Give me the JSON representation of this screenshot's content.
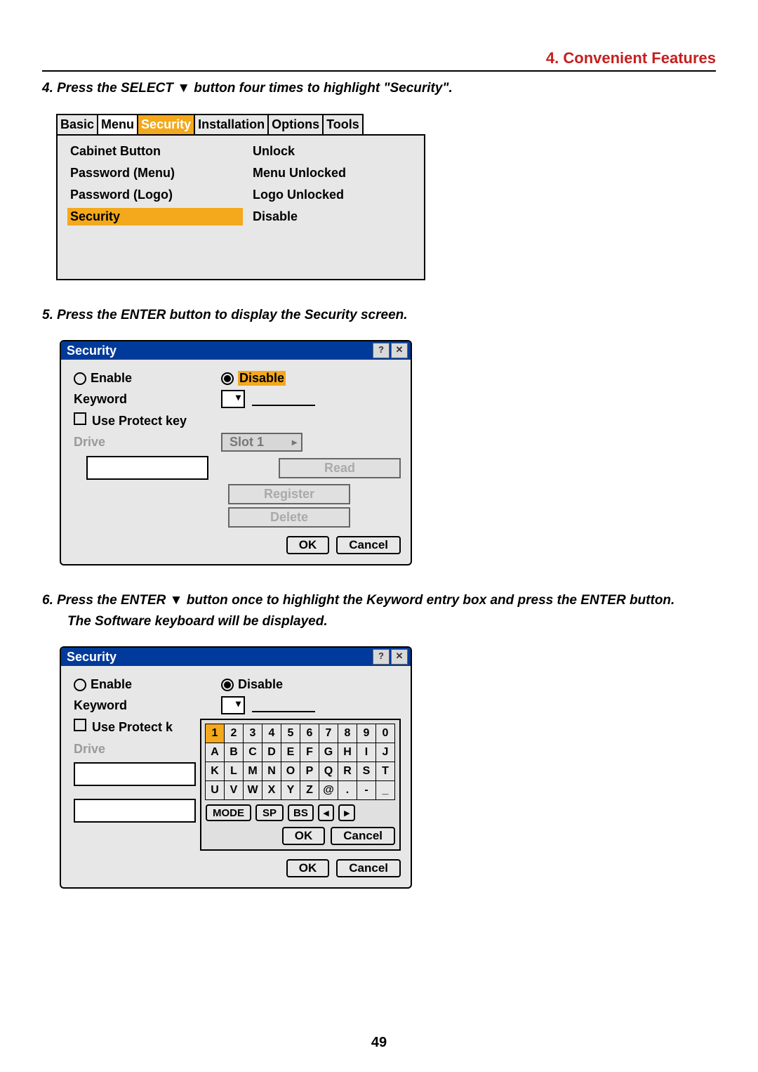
{
  "chapterTitle": "4. Convenient Features",
  "step4_pre": "4. Press the SELECT ",
  "triDown": "▼",
  "step4_post": " button four times to highlight \"Security\".",
  "tabs": [
    "Basic",
    "Menu",
    "Security",
    "Installation",
    "Options",
    "Tools"
  ],
  "p1_left": [
    "Cabinet Button",
    "Password (Menu)",
    "Password (Logo)",
    "Security"
  ],
  "p1_right": [
    "Unlock",
    "Menu Unlocked",
    "Logo Unlocked",
    "Disable"
  ],
  "step5": "5. Press the ENTER button to display the Security screen.",
  "dlg_title": "Security",
  "enable": "Enable",
  "disable": "Disable",
  "keyword": "Keyword",
  "useProtect": "Use Protect key",
  "useProtectShort": "Use Protect k",
  "drive": "Drive",
  "slot": "Slot 1",
  "read": "Read",
  "register": "Register",
  "delete": "Delete",
  "ok": "OK",
  "cancel": "Cancel",
  "step6a": "6. Press the ENTER ▼ button once to highlight the Keyword entry box and press the ENTER button.",
  "step6b": "The Software keyboard will be displayed.",
  "row0": [
    "1",
    "2",
    "3",
    "4",
    "5",
    "6",
    "7",
    "8",
    "9",
    "0"
  ],
  "row1": [
    "A",
    "B",
    "C",
    "D",
    "E",
    "F",
    "G",
    "H",
    "I",
    "J"
  ],
  "row2": [
    "K",
    "L",
    "M",
    "N",
    "O",
    "P",
    "Q",
    "R",
    "S",
    "T"
  ],
  "row3": [
    "U",
    "V",
    "W",
    "X",
    "Y",
    "Z",
    "@",
    ".",
    "-",
    "_"
  ],
  "mode": "MODE",
  "sp": "SP",
  "bs": "BS",
  "arrL": "◂",
  "arrR": "▸",
  "pageNum": "49"
}
